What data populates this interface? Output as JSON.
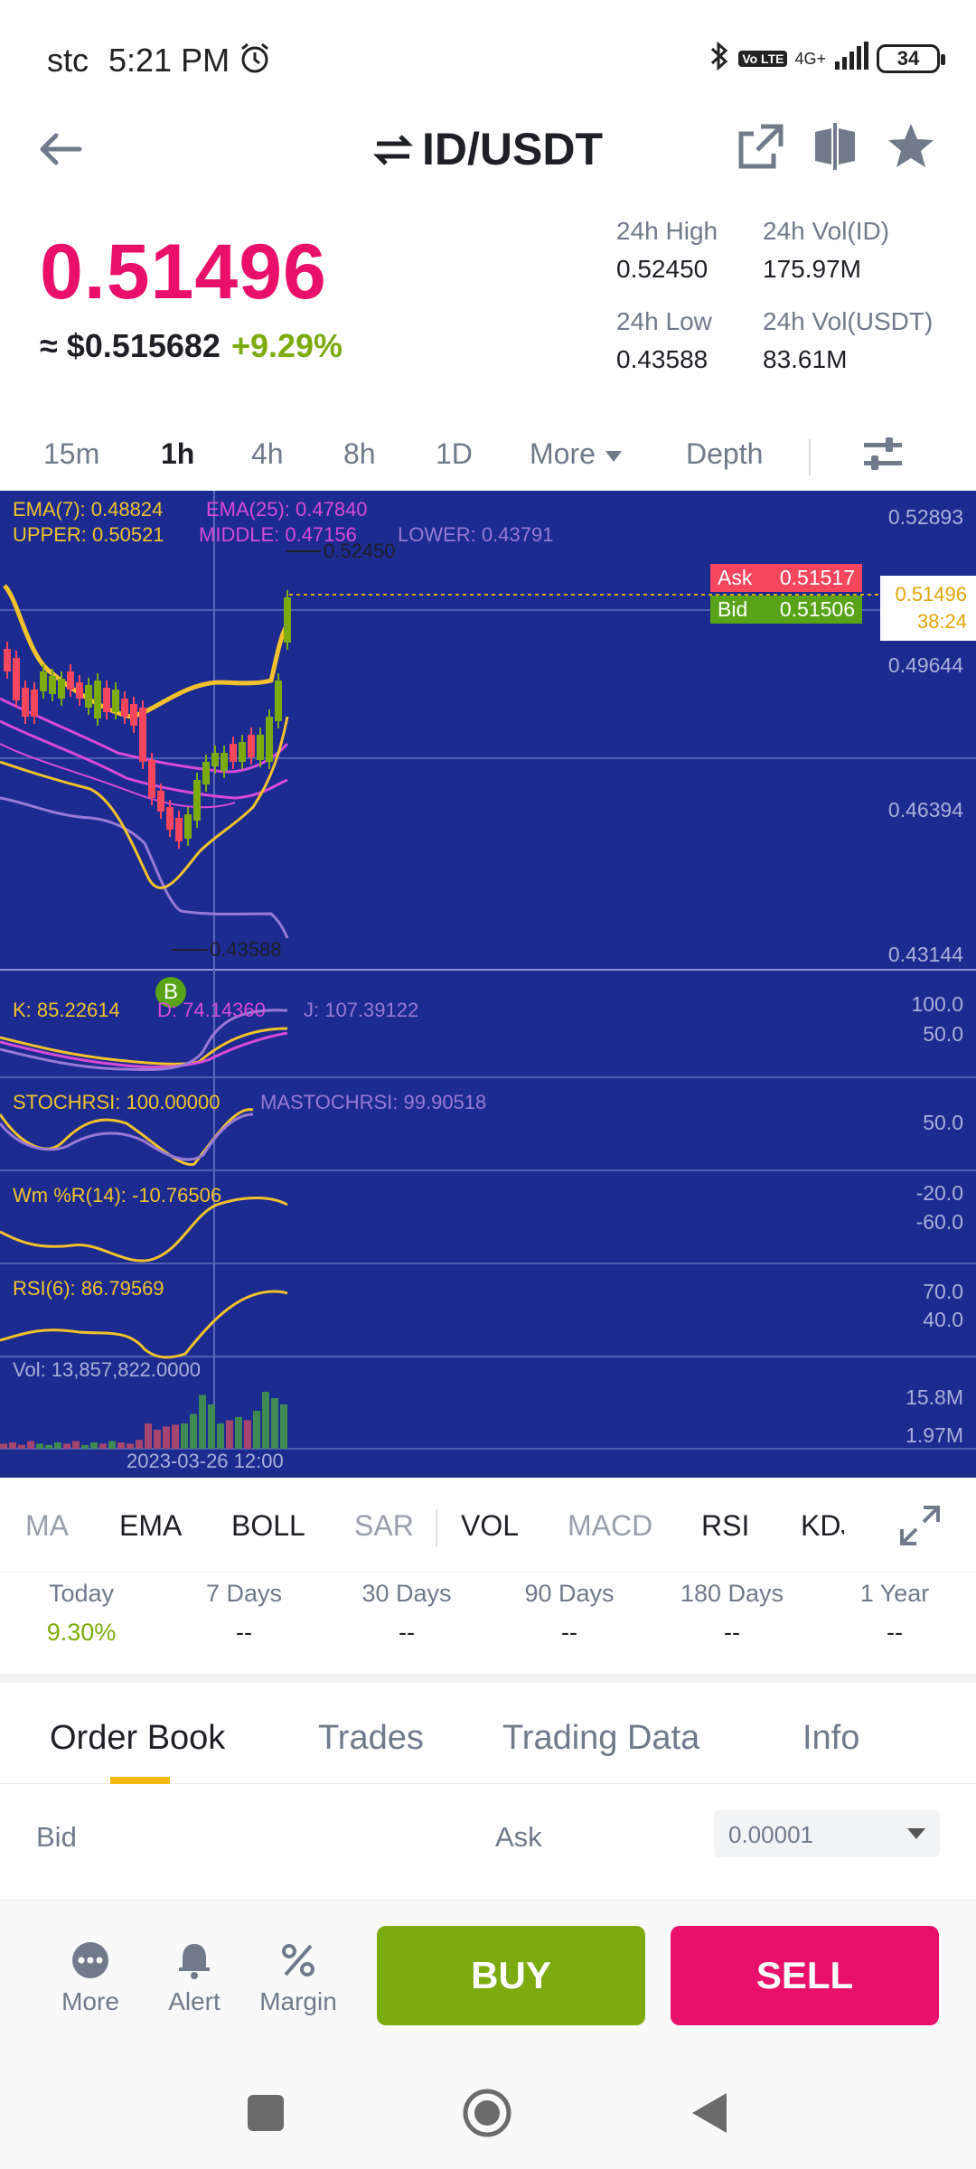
{
  "status_bar": {
    "carrier": "stc",
    "time": "5:21 PM",
    "network": "4G+",
    "volte": "Vo LTE",
    "battery": "34"
  },
  "header": {
    "title": "ID/USDT"
  },
  "price": {
    "last": "0.51496",
    "usd": "≈ $0.515682",
    "change": "+9.29%"
  },
  "stats": {
    "high_label": "24h High",
    "high_value": "0.52450",
    "vol_id_label": "24h Vol(ID)",
    "vol_id_value": "175.97M",
    "low_label": "24h Low",
    "low_value": "0.43588",
    "vol_usdt_label": "24h Vol(USDT)",
    "vol_usdt_value": "83.61M"
  },
  "timeframes": {
    "items": [
      "15m",
      "1h",
      "4h",
      "8h",
      "1D",
      "More",
      "Depth"
    ],
    "active": "1h"
  },
  "chart": {
    "ema7": "EMA(7): 0.48824",
    "ema25": "EMA(25): 0.47840",
    "upper": "UPPER: 0.50521",
    "middle": "MIDDLE: 0.47156",
    "lower": "LOWER: 0.43791",
    "high_marker": "0.52450",
    "low_marker": "0.43588",
    "y_labels": [
      "0.52893",
      "0.49644",
      "0.46394",
      "0.43144"
    ],
    "ask_label": "Ask",
    "ask_value": "0.51517",
    "bid_label": "Bid",
    "bid_value": "0.51506",
    "current_price": "0.51496",
    "countdown": "38:24",
    "b_marker": "B",
    "kdj_k": "K: 85.22614",
    "kdj_d": "D: 74.14360",
    "kdj_j": "J: 107.39122",
    "kdj_axis": [
      "100.0",
      "50.0"
    ],
    "stochrsi": "STOCHRSI: 100.00000",
    "mastochrsi": "MASTOCHRSI: 99.90518",
    "stoch_axis": [
      "50.0"
    ],
    "wmr": "Wm %R(14): -10.76506",
    "wmr_axis": [
      "-20.0",
      "-60.0"
    ],
    "rsi": "RSI(6): 86.79569",
    "rsi_axis": [
      "70.0",
      "40.0"
    ],
    "vol": "Vol: 13,857,822.0000",
    "vol_axis": [
      "15.8M",
      "1.97M"
    ],
    "date_label": "2023-03-26 12:00",
    "colors": {
      "background": "#1b2b8f",
      "up": "#7cab0f",
      "down": "#f6465d",
      "ema7": "#f3c12b",
      "ema25": "#d94ad6",
      "boll_lower": "#9a79d6"
    }
  },
  "indicator_tabs": [
    "MA",
    "EMA",
    "BOLL",
    "SAR",
    "VOL",
    "MACD",
    "RSI",
    "KDJ"
  ],
  "performance": [
    {
      "label": "Today",
      "value": "9.30%"
    },
    {
      "label": "7 Days",
      "value": "--"
    },
    {
      "label": "30 Days",
      "value": "--"
    },
    {
      "label": "90 Days",
      "value": "--"
    },
    {
      "label": "180 Days",
      "value": "--"
    },
    {
      "label": "1 Year",
      "value": "--"
    }
  ],
  "orderbook_tabs": [
    "Order Book",
    "Trades",
    "Trading Data",
    "Info"
  ],
  "orderbook": {
    "bid_label": "Bid",
    "ask_label": "Ask",
    "precision": "0.00001"
  },
  "actions": {
    "more": "More",
    "alert": "Alert",
    "margin": "Margin",
    "buy": "BUY",
    "sell": "SELL"
  }
}
